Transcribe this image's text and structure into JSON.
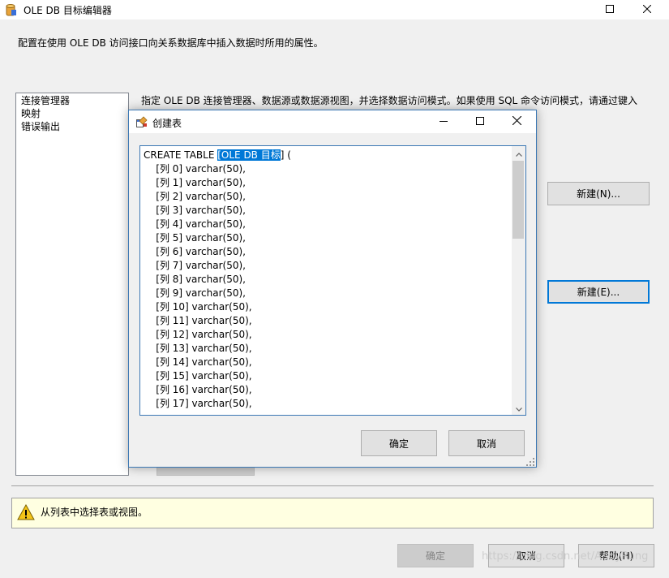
{
  "window": {
    "title": "OLE DB 目标编辑器",
    "description": "配置在使用 OLE DB 访问接口向关系数据库中插入数据时所用的属性。"
  },
  "pages": [
    {
      "label": "连接管理器"
    },
    {
      "label": "映射"
    },
    {
      "label": "错误输出"
    }
  ],
  "right_panel": {
    "hint": "指定 OLE DB 连接管理器、数据源或数据源视图，并选择数据访问模式。如果使用 SQL 命令访问模式，请通过键入",
    "new_connection_button": "新建(N)...",
    "new_table_button": "新建(E)..."
  },
  "message": {
    "text": "从列表中选择表或视图。",
    "icon": "warning-icon"
  },
  "footer": {
    "ok": "确定",
    "cancel": "取消",
    "help": "帮助(H)"
  },
  "dialog": {
    "title": "创建表",
    "icon": "create-table-icon",
    "sql": {
      "prefix": "CREATE TABLE ",
      "selected": "[OLE DB 目标",
      "suffix": "] (",
      "columns": [
        "[列 0] varchar(50),",
        "[列 1] varchar(50),",
        "[列 2] varchar(50),",
        "[列 3] varchar(50),",
        "[列 4] varchar(50),",
        "[列 5] varchar(50),",
        "[列 6] varchar(50),",
        "[列 7] varchar(50),",
        "[列 8] varchar(50),",
        "[列 9] varchar(50),",
        "[列 10] varchar(50),",
        "[列 11] varchar(50),",
        "[列 12] varchar(50),",
        "[列 13] varchar(50),",
        "[列 14] varchar(50),",
        "[列 15] varchar(50),",
        "[列 16] varchar(50),",
        "[列 17] varchar(50),"
      ]
    },
    "ok": "确定",
    "cancel": "取消"
  },
  "watermark": "https://blog.csdn.net/AndyRung",
  "colors": {
    "accent": "#0078d7",
    "message_background": "#ffffe1"
  }
}
